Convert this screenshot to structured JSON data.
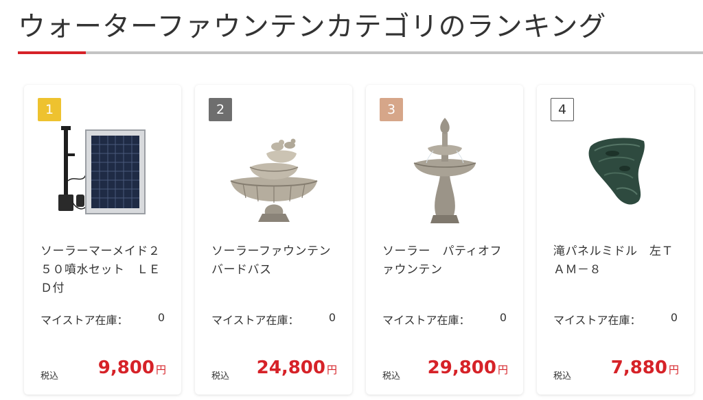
{
  "section": {
    "title": "ウォーターファウンテンカテゴリのランキング"
  },
  "colors": {
    "accent": "#d62228",
    "rule": "#c4c4c4",
    "rank_gold": "#eec22f",
    "rank_silver": "#6e6e6e",
    "rank_bronze": "#d6a689",
    "rank_default_border": "#555555"
  },
  "products": [
    {
      "rank": "1",
      "name": "ソーラーマーメイド２５０噴水セット　ＬＥＤ付",
      "stock_label": "マイストア在庫：",
      "stock": "0",
      "tax_label": "税込",
      "price": "9,800",
      "currency": "円",
      "image": "solar-fountain-pump-set"
    },
    {
      "rank": "2",
      "name": "ソーラーファウンテンバードバス",
      "stock_label": "マイストア在庫：",
      "stock": "0",
      "tax_label": "税込",
      "price": "24,800",
      "currency": "円",
      "image": "bird-bath-fountain"
    },
    {
      "rank": "3",
      "name": "ソーラー　パティオファウンテン",
      "stock_label": "マイストア在庫：",
      "stock": "0",
      "tax_label": "税込",
      "price": "29,800",
      "currency": "円",
      "image": "patio-tiered-fountain"
    },
    {
      "rank": "4",
      "name": "滝パネルミドル　左ＴＡＭ－８",
      "stock_label": "マイストア在庫：",
      "stock": "0",
      "tax_label": "税込",
      "price": "7,880",
      "currency": "円",
      "image": "waterfall-panel"
    }
  ]
}
